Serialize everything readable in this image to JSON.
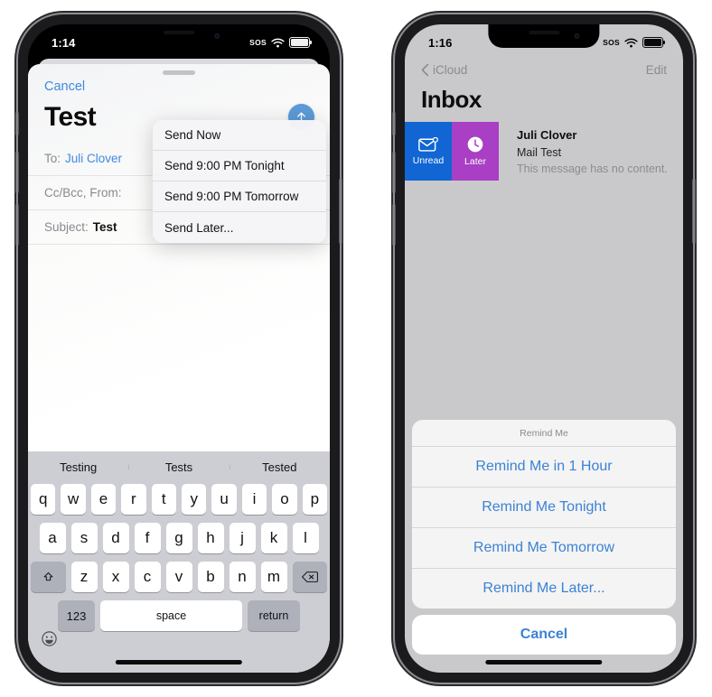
{
  "left_phone": {
    "status": {
      "time": "1:14",
      "sos": "SOS",
      "wifi_icon": "wifi-icon",
      "battery_icon": "battery-icon"
    },
    "compose": {
      "cancel_label": "Cancel",
      "title": "Test",
      "send_icon": "send-arrow-up-icon",
      "fields": [
        {
          "label": "To:",
          "value": "Juli Clover",
          "style": "link"
        },
        {
          "label": "Cc/Bcc, From:",
          "value": "",
          "style": "plain"
        },
        {
          "label": "Subject:",
          "value": "Test",
          "style": "bold"
        }
      ]
    },
    "context_menu": {
      "items": [
        "Send Now",
        "Send 9:00 PM Tonight",
        "Send 9:00 PM Tomorrow",
        "Send Later..."
      ]
    },
    "keyboard": {
      "predictions": [
        "Testing",
        "Tests",
        "Tested"
      ],
      "row1": [
        "q",
        "w",
        "e",
        "r",
        "t",
        "y",
        "u",
        "i",
        "o",
        "p"
      ],
      "row2": [
        "a",
        "s",
        "d",
        "f",
        "g",
        "h",
        "j",
        "k",
        "l"
      ],
      "row3": [
        "z",
        "x",
        "c",
        "v",
        "b",
        "n",
        "m"
      ],
      "shift_icon": "shift-arrow-up-icon",
      "backspace_icon": "backspace-delete-icon",
      "numbers_label": "123",
      "space_label": "space",
      "return_label": "return",
      "emoji_icon": "emoji-smiley-icon"
    }
  },
  "right_phone": {
    "status": {
      "time": "1:16",
      "sos": "SOS",
      "wifi_icon": "wifi-icon",
      "battery_icon": "battery-icon"
    },
    "nav": {
      "back_label": "iCloud",
      "back_icon": "chevron-left-icon",
      "edit_label": "Edit"
    },
    "page_title": "Inbox",
    "mail_row": {
      "swipe_actions": [
        {
          "label": "Unread",
          "icon": "envelope-unread-icon",
          "color": "#1166d3"
        },
        {
          "label": "Later",
          "icon": "clock-icon",
          "color": "#a83fc4"
        }
      ],
      "sender": "Juli Clover",
      "subject": "Mail Test",
      "preview": "This message has no content."
    },
    "action_sheet": {
      "title": "Remind Me",
      "items": [
        "Remind Me in 1 Hour",
        "Remind Me Tonight",
        "Remind Me Tomorrow",
        "Remind Me Later..."
      ],
      "cancel_label": "Cancel"
    }
  },
  "colors": {
    "accent_blue": "#3c82d4",
    "unread_blue": "#1166d3",
    "later_purple": "#a83fc4"
  }
}
